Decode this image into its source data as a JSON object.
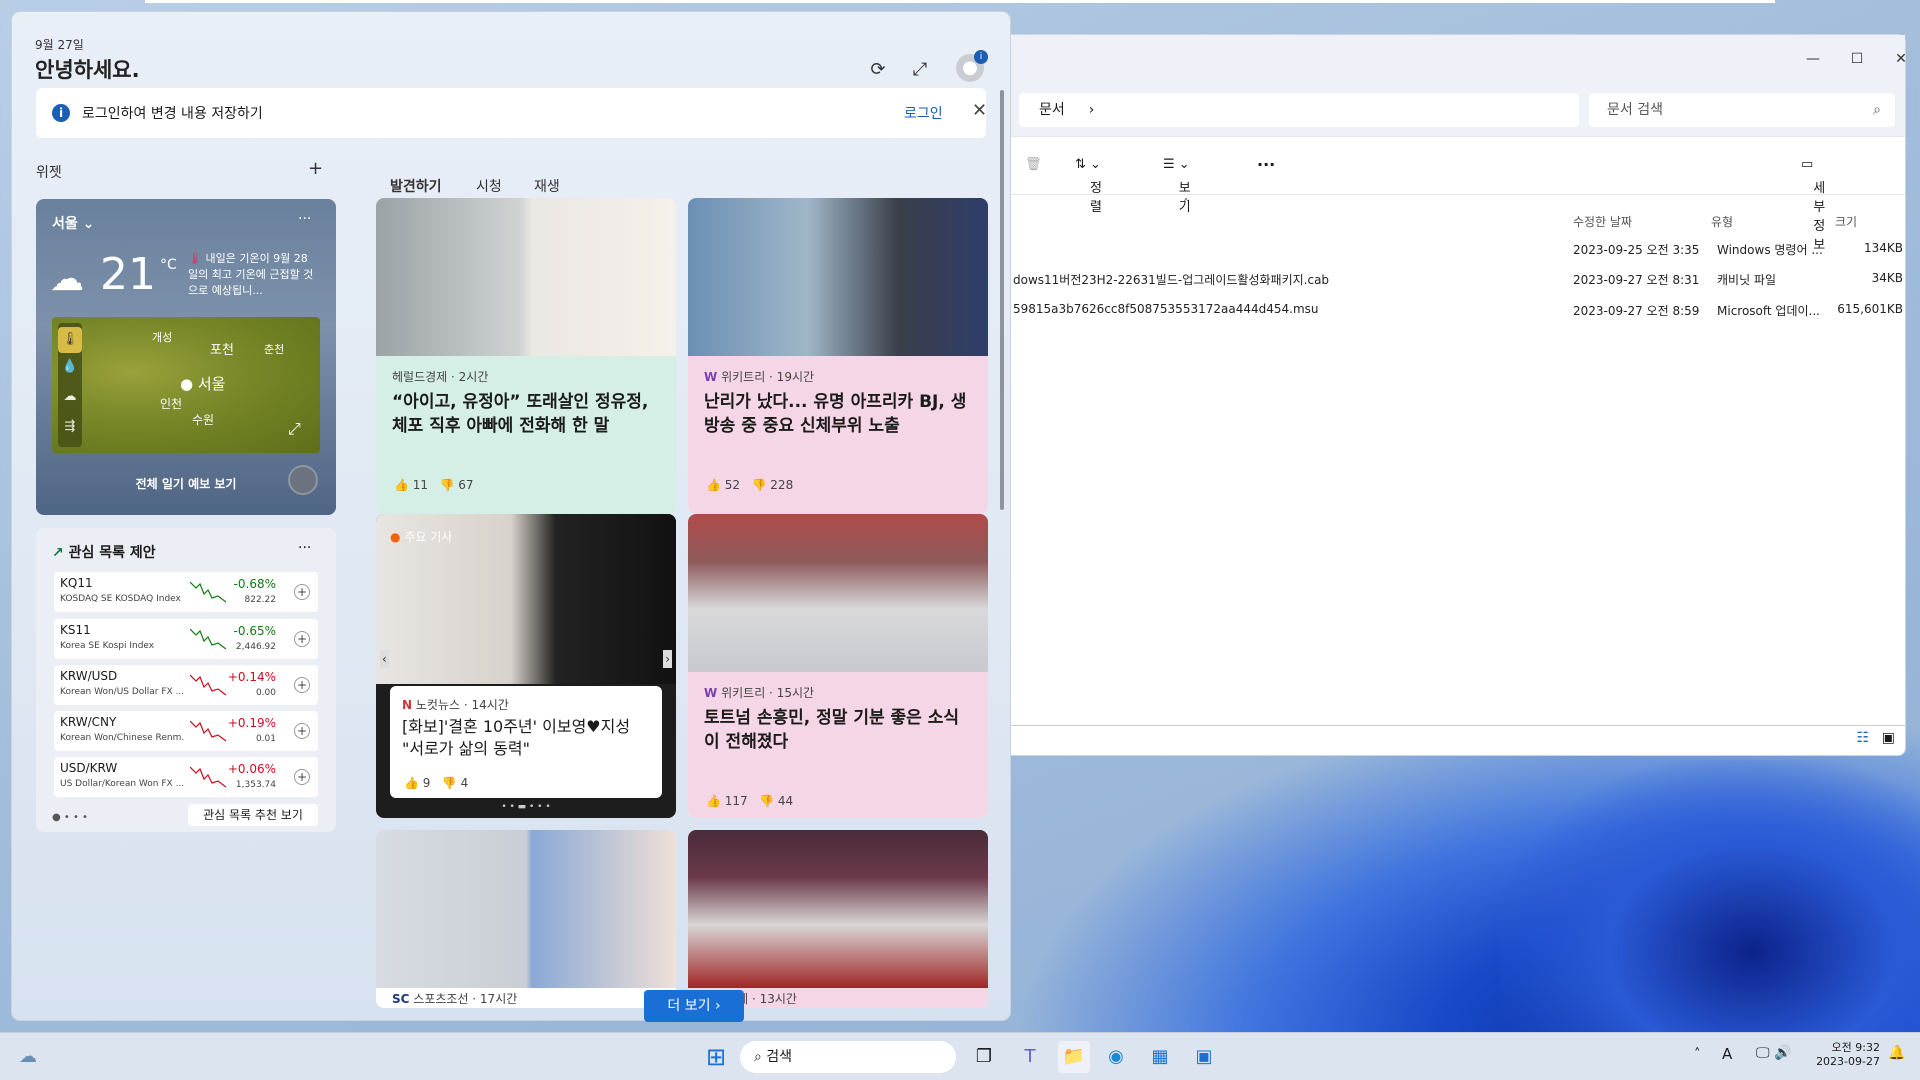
{
  "widgets": {
    "date": "9월 27일",
    "greeting": "안녕하세요.",
    "banner": {
      "text": "로그인하여 변경 내용 저장하기",
      "link": "로그인"
    },
    "widgets_label": "위젯",
    "weather": {
      "city": "서울",
      "temp": "21",
      "unit": "°C",
      "alert": "내일은 기온이 9월 28일의 최고 기온에 근접할 것으로 예상됩니...",
      "map_labels": [
        "개성",
        "포천",
        "춘천",
        "서울",
        "인천",
        "수원"
      ],
      "forecast_link": "전체 일기 예보 보기"
    },
    "watchlist": {
      "title": "관심 목록 제안",
      "link": "관심 목록 추천 보기",
      "items": [
        {
          "sym": "KQ11",
          "name": "KOSDAQ SE KOSDAQ Index",
          "change": "-0.68%",
          "price": "822.22",
          "color": "#107c10"
        },
        {
          "sym": "KS11",
          "name": "Korea SE Kospi Index",
          "change": "-0.65%",
          "price": "2,446.92",
          "color": "#107c10"
        },
        {
          "sym": "KRW/USD",
          "name": "Korean Won/US Dollar FX ...",
          "change": "+0.14%",
          "price": "0.00",
          "color": "#c50f1f"
        },
        {
          "sym": "KRW/CNY",
          "name": "Korean Won/Chinese Renm...",
          "change": "+0.19%",
          "price": "0.01",
          "color": "#c50f1f"
        },
        {
          "sym": "USD/KRW",
          "name": "US Dollar/Korean Won FX ...",
          "change": "+0.06%",
          "price": "1,353.74",
          "color": "#c50f1f"
        }
      ]
    },
    "tabs": [
      "발견하기",
      "시청",
      "재생"
    ],
    "news": [
      {
        "source": "헤럴드경제 · 2시간",
        "headline": "“아이고, 유정아” 또래살인 정유정, 체포 직후 아빠에 전화해 한 말",
        "likes": "11",
        "dislikes": "67",
        "bg": "#d5efe6"
      },
      {
        "source": "위키트리 · 19시간",
        "headline": "난리가 났다... 유명 아프리카 BJ, 생방송 중 중요 신체부위 노출",
        "likes": "52",
        "dislikes": "228",
        "bg": "#f5d6e6"
      },
      {
        "source": "노컷뉴스 · 14시간",
        "tag": "주요 기사",
        "headline": "[화보]'결혼 10주년' 이보영♥지성 \"서로가 삶의 동력\"",
        "likes": "9",
        "dislikes": "4",
        "bg": "#ffffff"
      },
      {
        "source": "위키트리 · 15시간",
        "headline": "토트넘 손흥민, 정말 기분 좋은 소식이 전해졌다",
        "likes": "117",
        "dislikes": "44",
        "bg": "#f5d6e6"
      },
      {
        "source": "스포츠조선 · 17시간",
        "bg": "#ffffff"
      },
      {
        "source": "매일경제 · 13시간",
        "bg": "#f5d6e6"
      }
    ],
    "more_button": "더 보기"
  },
  "explorer": {
    "path": "문서",
    "search_placeholder": "문서 검색",
    "toolbar": {
      "sort": "정렬",
      "view": "보기",
      "more": "...",
      "details": "세부 정보"
    },
    "columns": [
      "수정한 날짜",
      "유형",
      "크기"
    ],
    "files": [
      {
        "name": "",
        "date": "2023-09-25 오전 3:35",
        "type": "Windows 명령어 ...",
        "size": "134KB"
      },
      {
        "name": "dows11버전23H2-22631빌드-업그레이드활성화패키지.cab",
        "date": "2023-09-27 오전 8:31",
        "type": "캐비닛 파일",
        "size": "34KB"
      },
      {
        "name": "59815a3b7626cc8f508753553172aa444d454.msu",
        "date": "2023-09-27 오전 8:59",
        "type": "Microsoft 업데이...",
        "size": "615,601KB"
      }
    ]
  },
  "taskbar": {
    "search": "검색",
    "time": "오전 9:32",
    "date": "2023-09-27"
  }
}
